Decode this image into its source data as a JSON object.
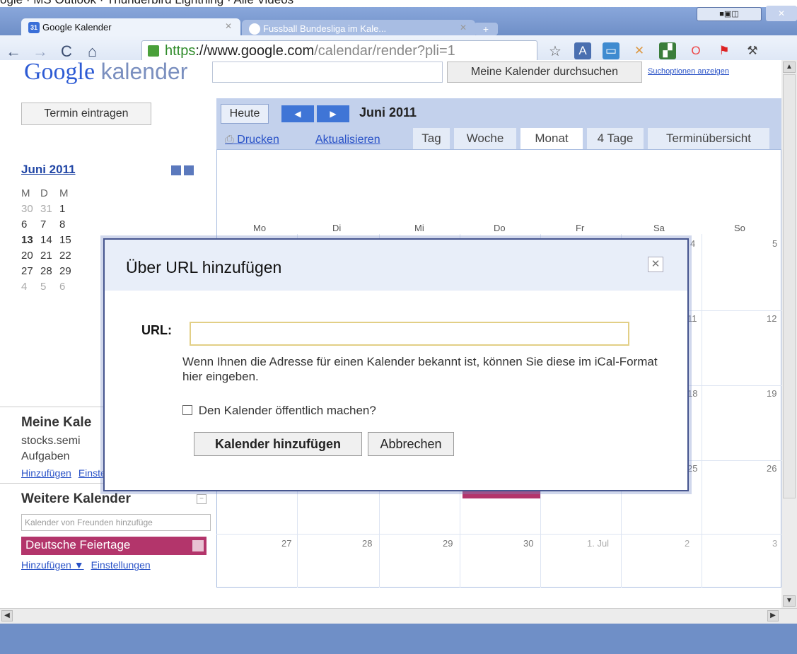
{
  "caption": "ogle · MS Outlook · Thunderbird Lightning · Alle Videos",
  "browser": {
    "tabs": [
      {
        "label": "Google Kalender"
      },
      {
        "label": "Fussball Bundesliga im Kale..."
      }
    ],
    "url": {
      "scheme": "https",
      "domain": "://www.google.com",
      "path": "/calendar/render?pli=1"
    },
    "window_badge": "■▣◫"
  },
  "header": {
    "logo": "Google",
    "product": "kalender",
    "search_button": "Meine Kalender durchsuchen",
    "search_options": "Suchoptionen anzeigen"
  },
  "sidebar": {
    "create_button": "Termin eintragen",
    "mini_month": "Juni 2011",
    "mini_header": [
      "M",
      "D",
      "M"
    ],
    "mini_rows": [
      [
        "30",
        "31",
        "1"
      ],
      [
        "6",
        "7",
        "8"
      ],
      [
        "13",
        "14",
        "15"
      ],
      [
        "20",
        "21",
        "22"
      ],
      [
        "27",
        "28",
        "29"
      ],
      [
        "4",
        "5",
        "6"
      ]
    ],
    "my_calendars_title": "Meine Kale",
    "my_calendars": [
      "stocks.semi",
      "Aufgaben"
    ],
    "my_links": [
      "Hinzufügen",
      "Einstellungen"
    ],
    "other_calendars_title": "Weitere Kalender",
    "friend_placeholder": "Kalender von Freunden hinzufüge",
    "holiday_calendar": "Deutsche Feiertage",
    "other_links": [
      "Hinzufügen ▼",
      "Einstellungen"
    ]
  },
  "calendar": {
    "today_button": "Heute",
    "month_title": "Juni 2011",
    "print": "Drucken",
    "refresh": "Aktualisieren",
    "views": [
      "Tag",
      "Woche",
      "Monat",
      "4 Tage",
      "Terminübersicht"
    ],
    "days": [
      "Mo",
      "Di",
      "Mi",
      "Do",
      "Fr",
      "Sa",
      "So"
    ],
    "visible_dates": {
      "row1": [
        "4",
        "5"
      ],
      "row2": [
        "11",
        "12"
      ],
      "row3": [
        "18",
        "19"
      ],
      "row4": [
        "25",
        "26"
      ],
      "row5": [
        "27",
        "28",
        "29",
        "30",
        "1. Jul",
        "2",
        "3"
      ]
    }
  },
  "dialog": {
    "title": "Über URL hinzufügen",
    "url_label": "URL:",
    "url_value": "",
    "help": "Wenn Ihnen die Adresse für einen Kalender bekannt ist, können Sie diese im iCal-Format hier eingeben.",
    "public_checkbox": "Den Kalender öffentlich machen?",
    "add_button": "Kalender hinzufügen",
    "cancel_button": "Abbrechen"
  }
}
